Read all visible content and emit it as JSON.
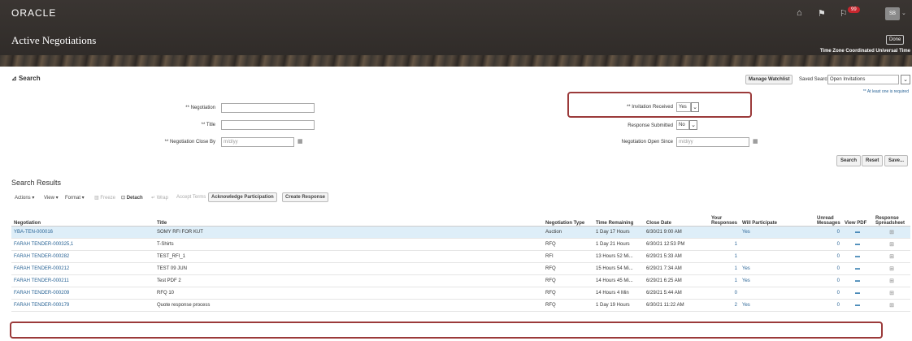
{
  "header": {
    "brand": "ORACLE",
    "page_title": "Active Negotiations",
    "notification_count": "99",
    "avatar_initials": "SB",
    "done_label": "Done",
    "timezone": "Time Zone Coordinated Universal Time"
  },
  "search": {
    "title": "Search",
    "manage_watchlist": "Manage Watchlist",
    "saved_search_label": "Saved Search",
    "saved_search_value": "Open Invitations",
    "required_note": "** At least one is required",
    "negotiation_label": "** Negotiation",
    "title_label": "** Title",
    "close_by_label": "** Negotiation Close By",
    "date_placeholder": "m/d/yy",
    "invitation_received_label": "** Invitation Received",
    "invitation_received_value": "Yes",
    "response_submitted_label": "Response Submitted",
    "response_submitted_value": "No",
    "open_since_label": "Negotiation Open Since",
    "search_button": "Search",
    "reset_button": "Reset",
    "save_button": "Save..."
  },
  "results": {
    "title": "Search Results",
    "toolbar": {
      "actions": "Actions ▾",
      "view": "View ▾",
      "format": "Format ▾",
      "freeze": "Freeze",
      "detach": "Detach",
      "wrap": "Wrap",
      "accept_terms": "Accept Terms",
      "acknowledge": "Acknowledge Participation",
      "create_response": "Create Response"
    },
    "columns": {
      "negotiation": "Negotiation",
      "title": "Title",
      "type": "Negotiation Type",
      "remaining": "Time Remaining",
      "close_date": "Close Date",
      "your_responses": "Your Responses",
      "will_participate": "Will Participate",
      "unread": "Unread Messages",
      "view_pdf": "View PDF",
      "spreadsheet": "Response Spreadsheet"
    },
    "rows": [
      {
        "negotiation": "YBA-TEN-000016",
        "title": "SOMY RFI FOR KUT",
        "type": "Auction",
        "remaining": "1 Day 17 Hours",
        "close_date": "6/30/21 9:00 AM",
        "responses": "",
        "participate": "Yes",
        "unread": "0"
      },
      {
        "negotiation": "FARAH TENDER-000325,1",
        "title": "T-Shirts",
        "type": "RFQ",
        "remaining": "1 Day 21 Hours",
        "close_date": "6/30/21 12:53 PM",
        "responses": "1",
        "participate": "",
        "unread": "0"
      },
      {
        "negotiation": "FARAH TENDER-000282",
        "title": "TEST_RFI_1",
        "type": "RFI",
        "remaining": "13 Hours 52 Mi...",
        "close_date": "6/29/21 5:33 AM",
        "responses": "1",
        "participate": "",
        "unread": "0"
      },
      {
        "negotiation": "FARAH TENDER-000212",
        "title": "TEST 09 JUN",
        "type": "RFQ",
        "remaining": "15 Hours 54 Mi...",
        "close_date": "6/29/21 7:34 AM",
        "responses": "1",
        "participate": "Yes",
        "unread": "0"
      },
      {
        "negotiation": "FARAH TENDER-000211",
        "title": "Test PDF 2",
        "type": "RFQ",
        "remaining": "14 Hours 45 Mi...",
        "close_date": "6/29/21 6:25 AM",
        "responses": "1",
        "participate": "Yes",
        "unread": "0"
      },
      {
        "negotiation": "FARAH TENDER-000209",
        "title": "RFQ 10",
        "type": "RFQ",
        "remaining": "14 Hours 4 Min",
        "close_date": "6/29/21 5:44 AM",
        "responses": "0",
        "participate": "",
        "unread": "0"
      },
      {
        "negotiation": "FARAH TENDER-000179",
        "title": "Quote response process",
        "type": "RFQ",
        "remaining": "1 Day 19 Hours",
        "close_date": "6/30/21 11:22 AM",
        "responses": "2",
        "participate": "Yes",
        "unread": "0"
      }
    ]
  }
}
